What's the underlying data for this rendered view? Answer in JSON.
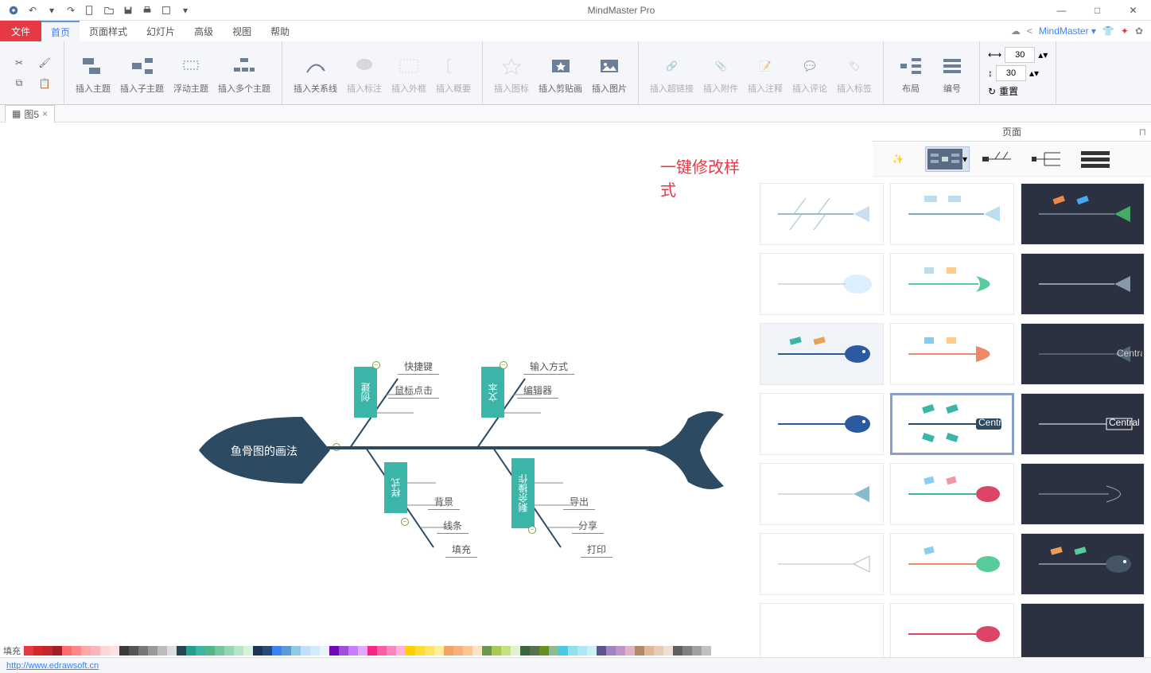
{
  "app": {
    "title": "MindMaster Pro",
    "brand": "MindMaster"
  },
  "menu": {
    "file": "文件",
    "items": [
      "首页",
      "页面样式",
      "幻灯片",
      "高级",
      "视图",
      "帮助"
    ],
    "active": 0
  },
  "ribbon": {
    "insertTopic": "插入主题",
    "insertSubTopic": "插入子主题",
    "floatTopic": "浮动主题",
    "multiTopic": "插入多个主题",
    "insertRelation": "插入关系线",
    "insertCallout": "插入标注",
    "insertBoundary": "插入外框",
    "insertSummary": "插入概要",
    "insertIcon": "插入图标",
    "insertClipart": "插入剪贴画",
    "insertImage": "插入图片",
    "insertHyperlink": "插入超链接",
    "insertAttachment": "插入附件",
    "insertNote": "插入注释",
    "insertComment": "插入评论",
    "insertTag": "插入标签",
    "layout": "布局",
    "numbering": "编号",
    "width": "30",
    "height": "30",
    "reset": "重置"
  },
  "docTab": {
    "name": "图5"
  },
  "panel": {
    "title": "页面"
  },
  "annotation": {
    "text": "一键修改样式"
  },
  "diagram": {
    "central": "鱼骨图的画法",
    "bones": [
      {
        "name": "创建",
        "leaves": [
          "快捷键",
          "鼠标点击"
        ]
      },
      {
        "name": "文本",
        "leaves": [
          "输入方式",
          "编辑器"
        ]
      },
      {
        "name": "样式",
        "leaves": [
          "背景",
          "线条",
          "填充"
        ]
      },
      {
        "name": "剩余操作",
        "leaves": [
          "导出",
          "分享",
          "打印"
        ]
      }
    ]
  },
  "status": {
    "fill": "填充",
    "url": "http://www.edrawsoft.cn"
  },
  "colors": [
    "#e63946",
    "#d62828",
    "#c1272d",
    "#a01f28",
    "#ff6b6b",
    "#ff8787",
    "#ffa8a8",
    "#ffb3ba",
    "#ffd6d6",
    "#ffe0e0",
    "#3b3b3b",
    "#555",
    "#777",
    "#999",
    "#bbb",
    "#ddd",
    "#264653",
    "#2a9d8f",
    "#3bb5a8",
    "#52b788",
    "#74c69d",
    "#95d5b2",
    "#b7e4c7",
    "#d8f3dc",
    "#1d3557",
    "#274c77",
    "#3b82f6",
    "#5b9bd5",
    "#8ecae6",
    "#bde0fe",
    "#d0ebff",
    "#e7f5ff",
    "#7209b7",
    "#9d4edd",
    "#c77dff",
    "#e0aaff",
    "#f72585",
    "#ff5da2",
    "#ff85c0",
    "#ffb3d9",
    "#ffd000",
    "#ffdd33",
    "#ffe566",
    "#ffee99",
    "#f4a261",
    "#f8b179",
    "#fcc591",
    "#fde1c5",
    "#6a994e",
    "#a7c957",
    "#c4e17f",
    "#e2f0cb",
    "#386641",
    "#52734d",
    "#6b8e23",
    "#8fbc8f",
    "#48cae4",
    "#90e0ef",
    "#ade8f4",
    "#caf0f8",
    "#5e548e",
    "#9f86c0",
    "#be95c4",
    "#e0b1cb",
    "#b08968",
    "#ddb892",
    "#e6ccb2",
    "#ede0d4",
    "#606060",
    "#808080",
    "#a0a0a0",
    "#c0c0c0"
  ]
}
